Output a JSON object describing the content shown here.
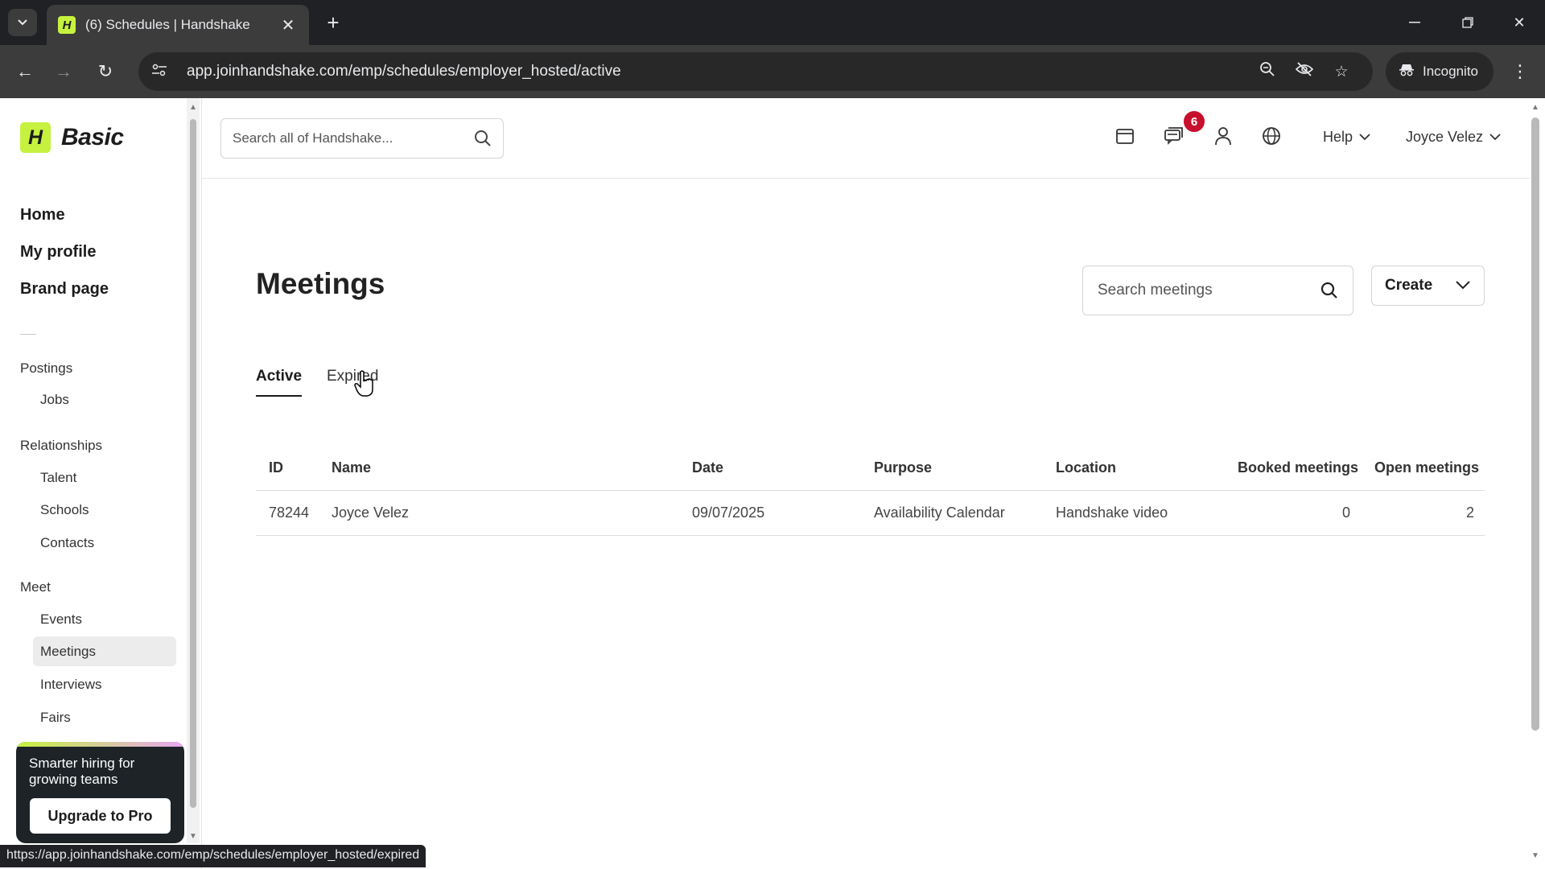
{
  "browser": {
    "tab_title": "(6) Schedules | Handshake",
    "favicon_letter": "H",
    "url": "app.joinhandshake.com/emp/schedules/employer_hosted/active",
    "incognito_label": "Incognito",
    "status_url": "https://app.joinhandshake.com/emp/schedules/employer_hosted/expired"
  },
  "sidebar": {
    "logo_letter": "H",
    "plan_label": "Basic",
    "main_items": [
      "Home",
      "My profile",
      "Brand page"
    ],
    "postings": {
      "label": "Postings",
      "items": [
        "Jobs"
      ]
    },
    "relationships": {
      "label": "Relationships",
      "items": [
        "Talent",
        "Schools",
        "Contacts"
      ]
    },
    "meet": {
      "label": "Meet",
      "items": [
        "Events",
        "Meetings",
        "Interviews",
        "Fairs"
      ],
      "active": "Meetings"
    },
    "promo": {
      "text": "Smarter hiring for growing teams",
      "button": "Upgrade to Pro"
    }
  },
  "header": {
    "search_placeholder": "Search all of Handshake...",
    "notification_count": "6",
    "help_label": "Help",
    "user_name": "Joyce Velez"
  },
  "main": {
    "title": "Meetings",
    "search_placeholder": "Search meetings",
    "create_label": "Create",
    "tabs": [
      {
        "label": "Active",
        "active": true
      },
      {
        "label": "Expired",
        "active": false
      }
    ],
    "table": {
      "columns": [
        "ID",
        "Name",
        "Date",
        "Purpose",
        "Location",
        "Booked meetings",
        "Open meetings"
      ],
      "rows": [
        {
          "id": "78244",
          "name": "Joyce Velez",
          "date": "09/07/2025",
          "purpose": "Availability Calendar",
          "location": "Handshake video",
          "booked": "0",
          "open": "2"
        }
      ]
    }
  },
  "colors": {
    "brand_accent": "#c6f23f",
    "badge_red": "#c8102e",
    "promo_bg": "#1d2327"
  }
}
